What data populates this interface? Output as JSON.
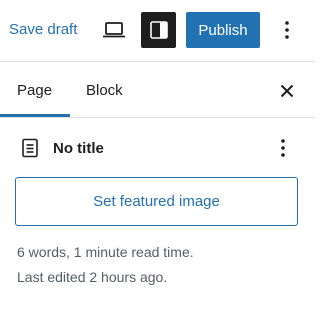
{
  "toolbar": {
    "save_draft_label": "Save draft",
    "preview_icon": "laptop-icon",
    "settings_icon": "sidebar-panel-icon",
    "publish_label": "Publish",
    "more_icon": "kebab-menu-icon"
  },
  "tabs": [
    {
      "label": "Page",
      "active": true
    },
    {
      "label": "Block",
      "active": false
    }
  ],
  "close_icon": "close-icon",
  "document": {
    "icon": "document-icon",
    "title": "No title",
    "more_icon": "kebab-menu-icon"
  },
  "featured_image": {
    "label": "Set featured image"
  },
  "meta": {
    "stats": "6 words, 1 minute read time.",
    "last_edited": "Last edited 2 hours ago."
  },
  "colors": {
    "accent": "#2271b1",
    "dark": "#1e1e1e",
    "muted_text": "#555d66",
    "divider": "#e0e0e0"
  }
}
